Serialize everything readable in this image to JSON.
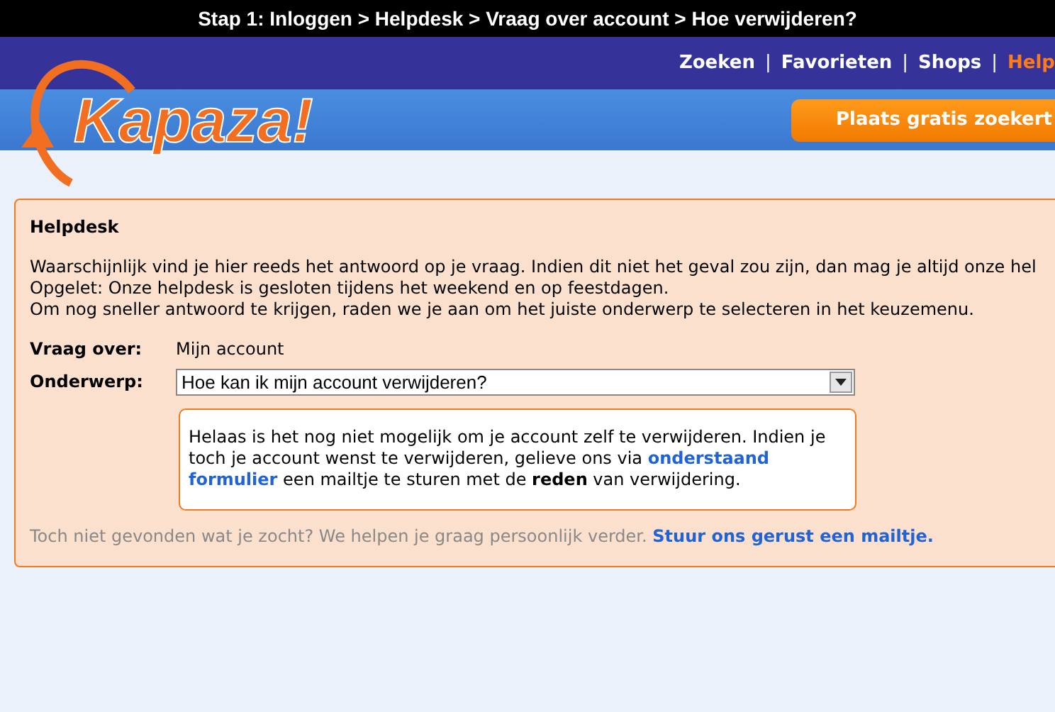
{
  "breadcrumb": "Stap 1: Inloggen > Helpdesk > Vraag over account > Hoe verwijderen?",
  "logo": "Kapaza!",
  "nav": [
    {
      "label": "Zoeken",
      "selected": false
    },
    {
      "label": "Favorieten",
      "selected": false
    },
    {
      "label": "Shops",
      "selected": false
    },
    {
      "label": "Help",
      "selected": true
    }
  ],
  "nav_separator": "|",
  "cta_button": "Plaats gratis zoekert",
  "panel": {
    "title": "Helpdesk",
    "intro": [
      "Waarschijnlijk vind je hier reeds het antwoord op je vraag. Indien dit niet het geval zou zijn, dan mag je altijd onze hel",
      "Opgelet: Onze helpdesk is gesloten tijdens het weekend en op feestdagen.",
      "Om nog sneller antwoord te krijgen, raden we je aan om het juiste onderwerp te selecteren in het keuzemenu."
    ],
    "question_label": "Vraag over:",
    "question_value": "Mijn account",
    "subject_label": "Onderwerp:",
    "subject_value": "Hoe kan ik mijn account verwijderen?",
    "answer_before": "Helaas is het nog niet mogelijk om je account zelf te verwijderen. Indien je toch je account wenst te verwijderen, gelieve ons via",
    "answer_link_parts": [
      "onderstaand",
      "formulier"
    ],
    "answer_after": "een mailtje te sturen met de **reden** van verwijdering.",
    "footer_text": "Toch niet gevonden wat je zocht? We helpen je graag persoonlijk verder.",
    "footer_link": "Stuur ons gerust een mailtje."
  }
}
